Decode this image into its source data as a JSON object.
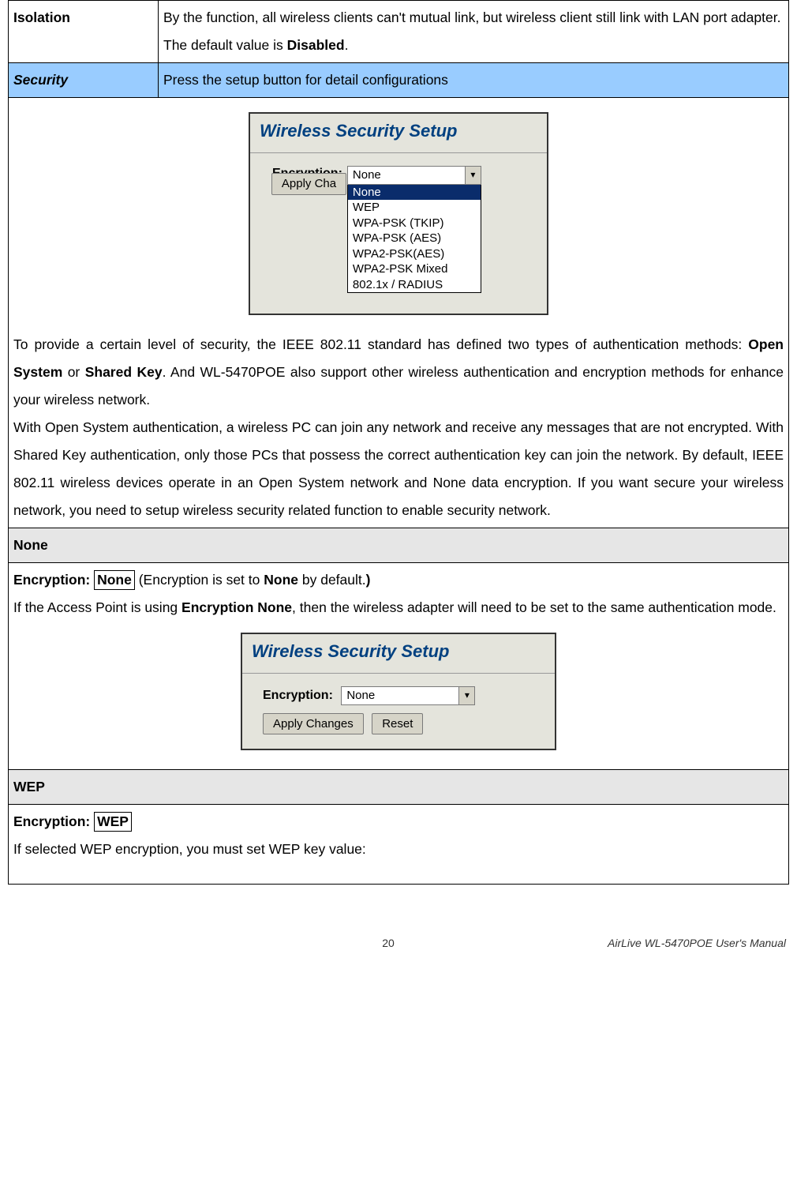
{
  "row_isolation": {
    "label": "Isolation",
    "desc_line1": "By the function, all wireless clients can't mutual link, but wireless client still link with LAN port adapter.",
    "desc_line2_prefix": "The default value is ",
    "desc_line2_bold": "Disabled",
    "desc_line2_suffix": "."
  },
  "row_security": {
    "label": "Security",
    "desc": "Press the setup button for detail configurations"
  },
  "wss1": {
    "title": "Wireless Security Setup",
    "label": "Encryption:",
    "selected": "None",
    "options": [
      "None",
      "WEP",
      "WPA-PSK (TKIP)",
      "WPA-PSK (AES)",
      "WPA2-PSK(AES)",
      "WPA2-PSK Mixed",
      "802.1x / RADIUS"
    ],
    "apply_btn": "Apply Cha"
  },
  "security_paragraph_parts": {
    "p1_a": "To provide a certain level of security, the IEEE 802.11 standard has defined two types of authentication methods: ",
    "p1_b1": "Open System",
    "p1_mid": " or ",
    "p1_b2": "Shared Key",
    "p1_c": ". And WL-5470POE also support other wireless authentication and encryption methods for enhance your wireless network.",
    "p2": "With Open System authentication, a wireless PC can join any network and receive any messages that are not encrypted. With Shared Key authentication, only those PCs that possess the correct authentication key can join the network. By default, IEEE 802.11 wireless devices operate in an Open System network and None data encryption. If you want secure your wireless network, you need to setup wireless security related function to enable security network."
  },
  "none_header": "None",
  "none_section": {
    "line1_a": "Encryption: ",
    "line1_boxed": "None",
    "line1_b": " (Encryption is set to ",
    "line1_bold": "None",
    "line1_c": " by default.",
    "line1_d": ")",
    "line2_a": "If the Access Point is using ",
    "line2_bold": "Encryption None",
    "line2_b": ", then the wireless adapter will need to be set to the same authentication mode.",
    "wss2": {
      "title": "Wireless Security Setup",
      "label": "Encryption:",
      "selected": "None",
      "apply": "Apply Changes",
      "reset": "Reset"
    }
  },
  "wep_header": "WEP",
  "wep_section": {
    "line1_a": "Encryption: ",
    "line1_boxed": "WEP",
    "line2": "If selected WEP encryption, you must set WEP key value:"
  },
  "footer": {
    "page": "20",
    "manual_a": "AirLive ",
    "manual_b": "WL-5470POE User's Manual"
  }
}
